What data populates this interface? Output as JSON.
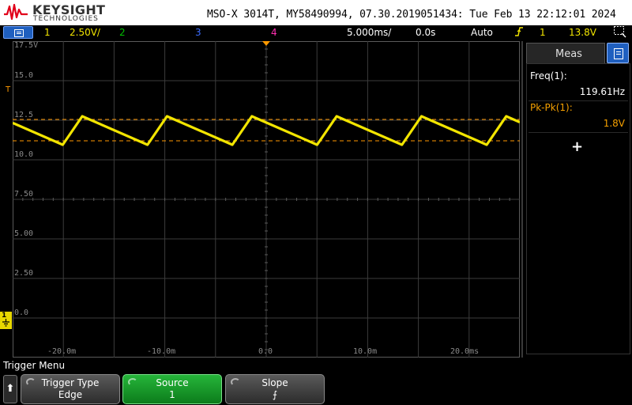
{
  "header": {
    "brand": "KEYSIGHT",
    "brand_sub": "TECHNOLOGIES",
    "instrument_id": "MSO-X 3014T, MY58490994, 07.30.2019051434: Tue Feb 13 22:12:01 2024"
  },
  "status": {
    "ch1_num": "1",
    "ch1_scale": "2.50V/",
    "ch2_num": "2",
    "ch3_num": "3",
    "ch4_num": "4",
    "timebase": "5.000ms/",
    "delay": "0.0s",
    "trigger_mode": "Auto",
    "trigger_slope_icon": "rising-edge-icon",
    "trigger_source": "1",
    "trigger_level": "13.8V"
  },
  "grid": {
    "y_labels": [
      "17.5V",
      "15.0",
      "12.5",
      "10.0",
      "7.50",
      "5.00",
      "2.50",
      "0.0"
    ],
    "x_labels": [
      "-20.0m",
      "-10.0m",
      "0.0",
      "10.0m",
      "20.0ms"
    ],
    "ch1_marker": "1",
    "trigger_marker": "T"
  },
  "chart_data": {
    "type": "line",
    "series": [
      {
        "name": "Channel 1",
        "color": "#f2e500",
        "period_ms": 8.36,
        "max_v": 14.0,
        "min_v": 12.2,
        "first_peak_ms": -26.5,
        "ramp_fraction": 0.23
      }
    ],
    "x_range_ms": [
      -25.0,
      25.0
    ],
    "y_range_v": [
      -1.25,
      18.75
    ],
    "trigger_level_v": 13.8,
    "lower_cursor_v": 12.45,
    "grid": true
  },
  "measurements": {
    "title": "Meas",
    "items": [
      {
        "label": "Freq(1):",
        "value": "119.61Hz",
        "color": "#ffffff"
      },
      {
        "label": "Pk-Pk(1):",
        "value": "1.8V",
        "color": "#f5a000"
      }
    ],
    "add_symbol": "+"
  },
  "softkeys": {
    "menu_title": "Trigger Menu",
    "back_symbol": "⬆",
    "keys": [
      {
        "label": "Trigger Type",
        "value": "Edge"
      },
      {
        "label": "Source",
        "value": "1"
      },
      {
        "label": "Slope",
        "value": "⨍"
      }
    ]
  },
  "colors": {
    "ch1": "#f2e500",
    "ch2": "#00c000",
    "ch3": "#3b6cff",
    "ch4": "#ff2fb0",
    "trigger": "#ff9900",
    "accent_blue": "#1f5fbf",
    "softkey_active": "#1a9c2c"
  }
}
